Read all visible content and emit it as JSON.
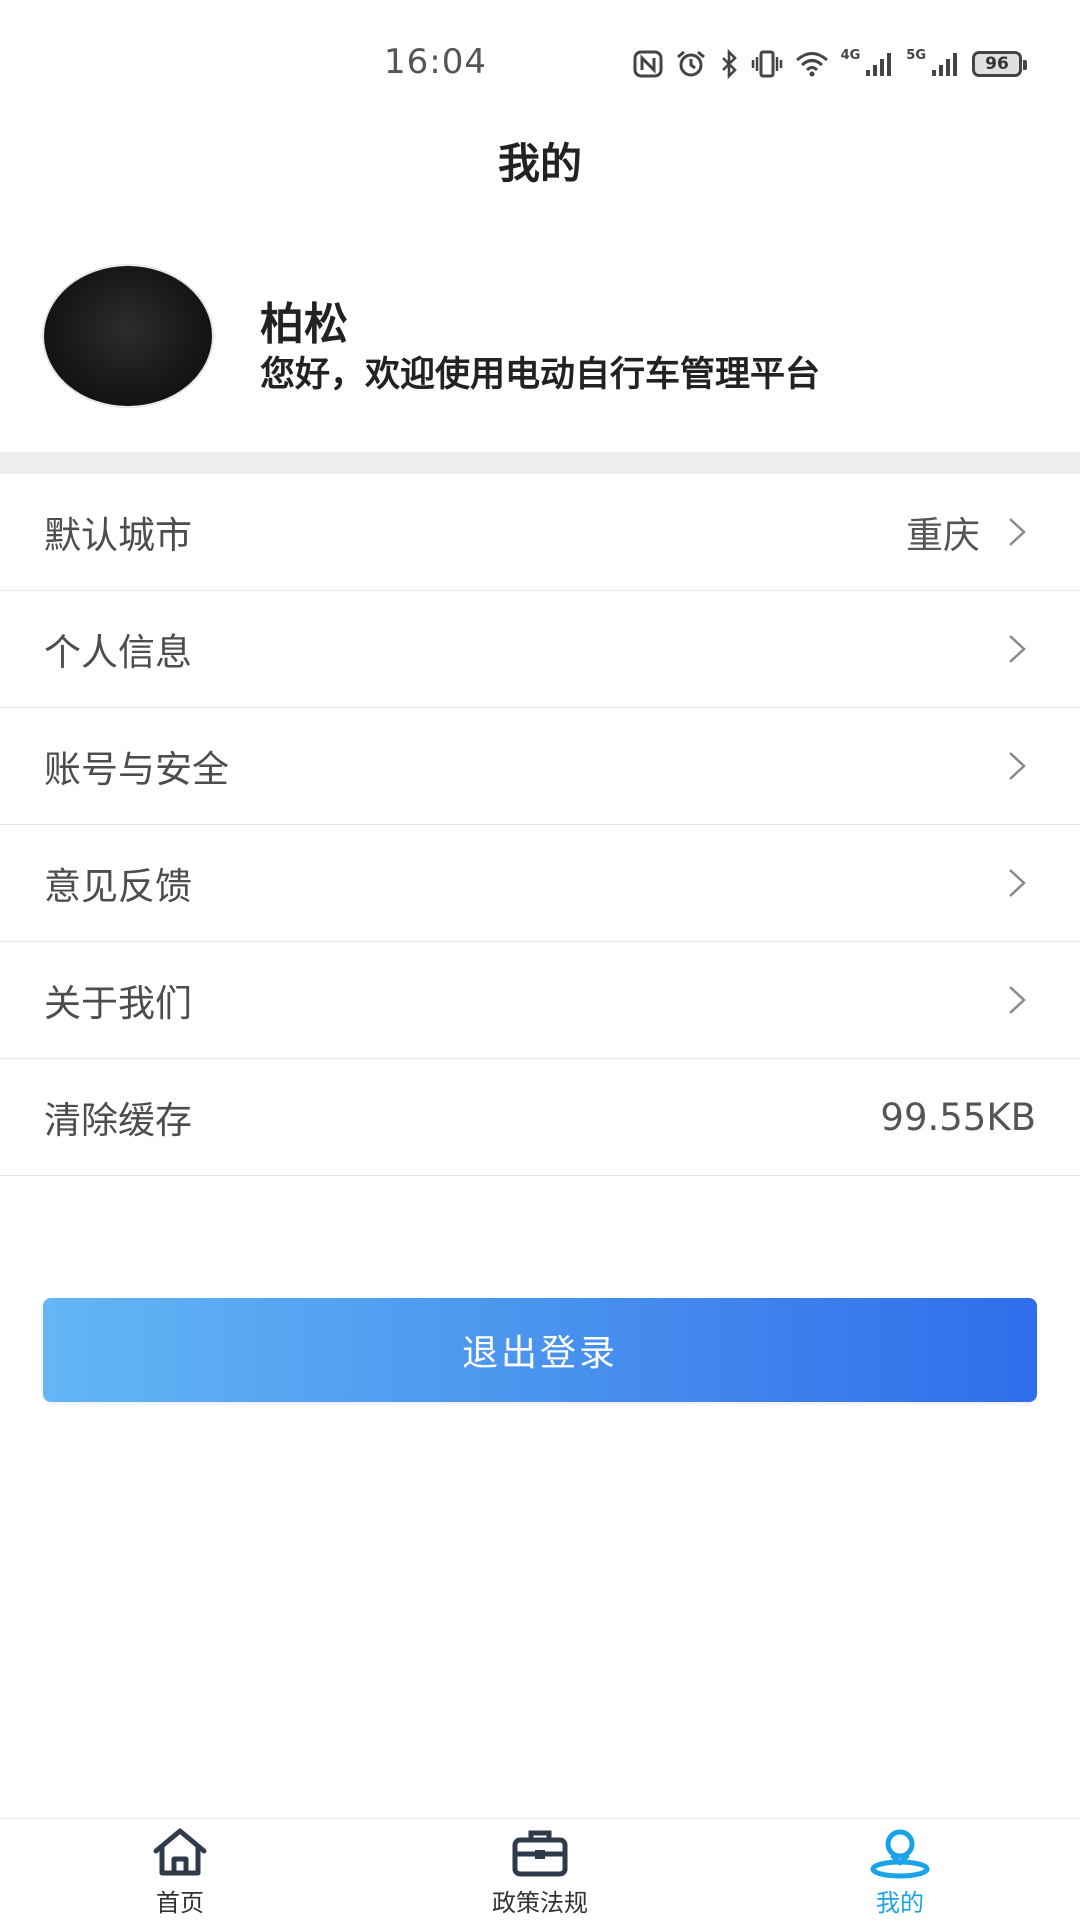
{
  "status_bar": {
    "time": "16:04",
    "net_4g": "4G",
    "net_5g": "5G",
    "battery": "96",
    "icons": [
      "nfc-icon",
      "alarm-icon",
      "bluetooth-icon",
      "vibrate-icon",
      "wifi-icon",
      "signal-4g-icon",
      "signal-5g-icon",
      "battery-icon"
    ]
  },
  "header": {
    "title": "我的"
  },
  "profile": {
    "name": "柏松",
    "greeting": "您好，欢迎使用电动自行车管理平台"
  },
  "menu": [
    {
      "label": "默认城市",
      "value": "重庆",
      "chevron": true
    },
    {
      "label": "个人信息",
      "value": "",
      "chevron": true
    },
    {
      "label": "账号与安全",
      "value": "",
      "chevron": true
    },
    {
      "label": "意见反馈",
      "value": "",
      "chevron": true
    },
    {
      "label": "关于我们",
      "value": "",
      "chevron": true
    },
    {
      "label": "清除缓存",
      "value": "99.55KB",
      "chevron": false
    }
  ],
  "logout_label": "退出登录",
  "bottom_nav": [
    {
      "label": "首页",
      "icon": "home-icon",
      "active": false
    },
    {
      "label": "政策法规",
      "icon": "briefcase-icon",
      "active": false
    },
    {
      "label": "我的",
      "icon": "user-pin-icon",
      "active": true
    }
  ],
  "colors": {
    "accent": "#1aa3e8",
    "button_gradient_start": "#64b6f5",
    "button_gradient_end": "#2f6deb"
  }
}
